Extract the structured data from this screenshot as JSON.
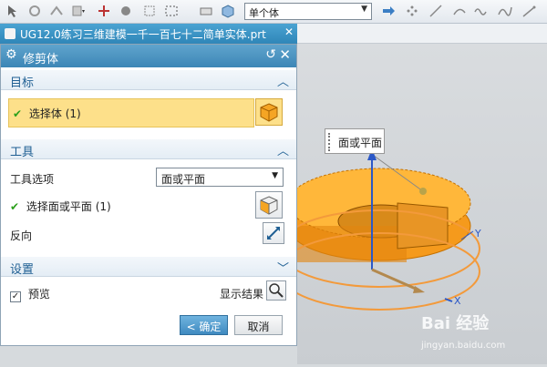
{
  "toolbar": {
    "filter_value": "单个体"
  },
  "window": {
    "title": "UG12.0练习三维建模一千一百七十二简单实体.prt"
  },
  "dialog": {
    "title": "修剪体",
    "sections": {
      "target": {
        "title": "目标",
        "select_body_label": "选择体 (1)"
      },
      "tool": {
        "title": "工具",
        "tool_option_label": "工具选项",
        "tool_option_value": "面或平面",
        "select_face_label": "选择面或平面 (1)",
        "reverse_label": "反向"
      },
      "settings": {
        "title": "设置"
      }
    },
    "preview_label": "预览",
    "show_result_label": "显示结果",
    "ok_label": "< 确定 >",
    "cancel_label": "取消"
  },
  "viewport": {
    "tooltip_text": "面或平面",
    "axis_y": "Y",
    "axis_x": "X",
    "watermark": "Bai 经验",
    "watermark_sub": "jingyan.baidu.com"
  },
  "colors": {
    "dialog_header": "#3d86b6",
    "selected_row": "#fde08a",
    "model_orange": "#f59a1c",
    "section_title": "#1f5f93"
  }
}
